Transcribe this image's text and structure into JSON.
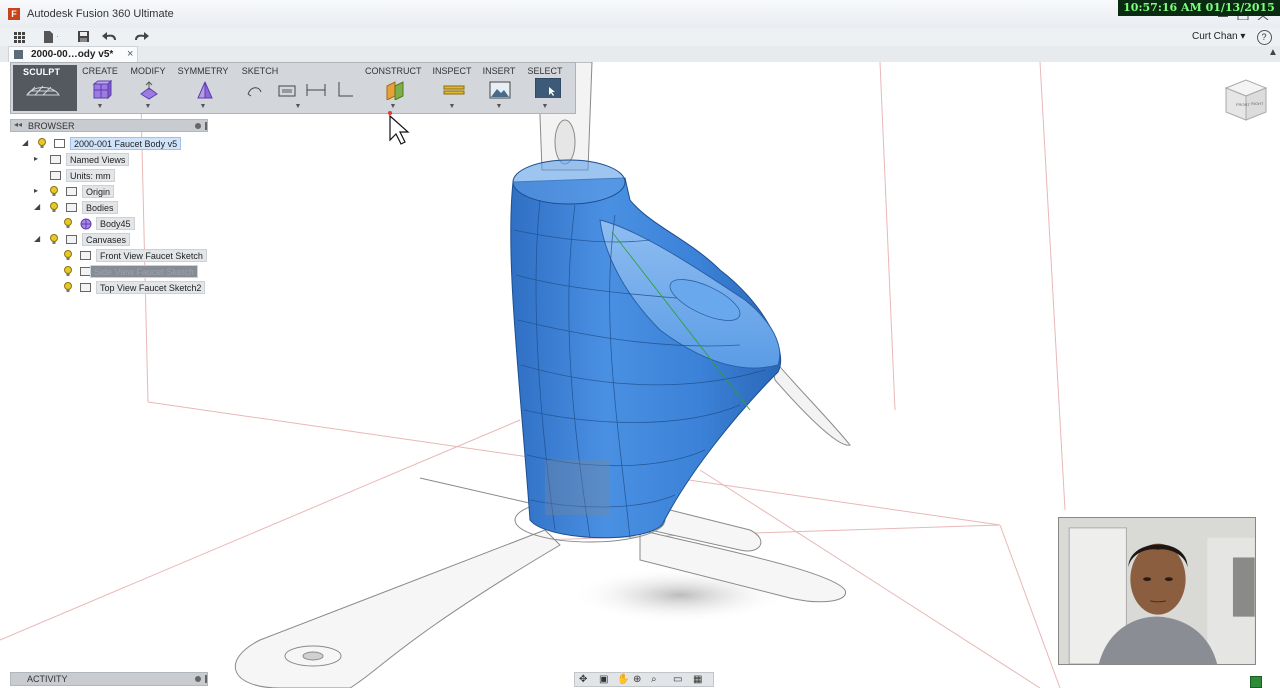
{
  "app": {
    "window_title": "Autodesk Fusion 360 Ultimate",
    "icon_letter": "F",
    "overlay_clock": "10:57:16 AM 01/13/2015"
  },
  "quick_access": {
    "user_name": "Curt Chan",
    "help_label": "?"
  },
  "document_tab": {
    "label": "2000-00…ody v5*",
    "close": "×"
  },
  "toolbar": {
    "workspace_label": "SCULPT",
    "groups": [
      {
        "label": "CREATE",
        "icon": "box-icon"
      },
      {
        "label": "MODIFY",
        "icon": "edit-form-icon"
      },
      {
        "label": "SYMMETRY",
        "icon": "mirror-icon"
      },
      {
        "label": "SKETCH",
        "icon": "sketch-tools-icon"
      },
      {
        "label": "CONSTRUCT",
        "icon": "offset-plane-icon"
      },
      {
        "label": "INSPECT",
        "icon": "measure-icon"
      },
      {
        "label": "INSERT",
        "icon": "attach-canvas-icon"
      },
      {
        "label": "SELECT",
        "icon": "select-icon"
      }
    ]
  },
  "browser": {
    "title": "BROWSER",
    "items": [
      {
        "label": "2000-001 Faucet Body v5",
        "selected": true
      },
      {
        "label": "Named Views"
      },
      {
        "label": "Units: mm"
      },
      {
        "label": "Origin"
      },
      {
        "label": "Bodies"
      },
      {
        "label": "Body45"
      },
      {
        "label": "Canvases"
      },
      {
        "label": "Front View Faucet Sketch"
      },
      {
        "label": "Side View Faucet Sketch"
      },
      {
        "label": "Top View Faucet Sketch2"
      }
    ]
  },
  "activity": {
    "title": "ACTIVITY"
  },
  "viewcube": {
    "front": "FRONT",
    "right": "RIGHT"
  },
  "colors": {
    "model_blue": "#3f86d8",
    "toolbar_bg": "#d3d7db",
    "workspace_bg": "#53595f",
    "clock_bg": "#0b2a12",
    "clock_fg": "#7dff7d"
  }
}
